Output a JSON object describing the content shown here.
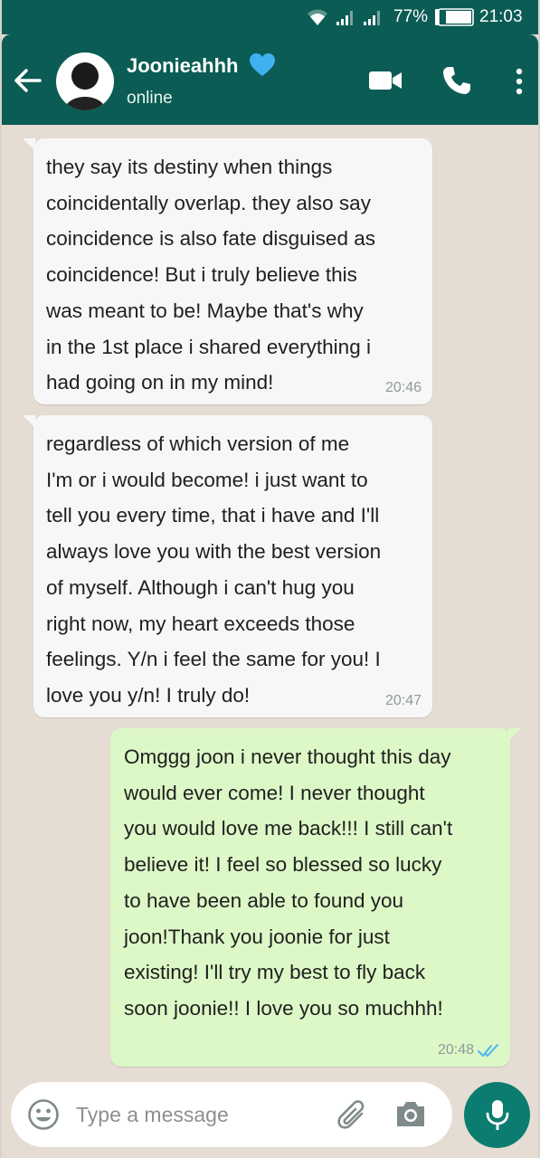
{
  "status_bar": {
    "battery_percent": "77%",
    "time": "21:03",
    "icons": [
      "wifi-icon",
      "signal-icon",
      "signal-icon",
      "battery-icon"
    ]
  },
  "header": {
    "contact_name": "Joonieahhh",
    "status": "online",
    "icons": [
      "back-arrow-icon",
      "avatar",
      "blue-heart-icon",
      "video-call-icon",
      "phone-icon",
      "more-vert-icon"
    ]
  },
  "messages": [
    {
      "direction": "incoming",
      "text": "they say its destiny when things\ncoincidentally overlap. they also say\ncoincidence is also fate disguised as\ncoincidence! But i truly believe this\nwas meant to be! Maybe that's why\nin the 1st place i shared everything i\nhad going on in my mind!",
      "time": "20:46"
    },
    {
      "direction": "incoming",
      "text": "regardless of which version of me\nI'm or i would become! i just want to\ntell you every time, that i have and I'll\nalways love you with the best version\nof myself. Although i can't hug you\nright now, my heart exceeds those\nfeelings. Y/n i feel the same for you! I\nlove you y/n! I truly do!",
      "time": "20:47"
    },
    {
      "direction": "outgoing",
      "text": "Omggg joon i never thought this day\nwould ever come! I never thought\nyou would love me back!!! I still can't\nbelieve it! I feel so blessed so lucky\nto have been able to found you\njoon!Thank you joonie for just\nexisting! I'll try my best to fly back\nsoon joonie!! I love you so muchhh!",
      "time": "20:48",
      "read_status": "read-double-tick-icon"
    }
  ],
  "composer": {
    "placeholder": "Type a message",
    "value": "",
    "icons": [
      "emoji-icon",
      "paperclip-icon",
      "camera-icon",
      "mic-icon"
    ]
  },
  "colors": {
    "header": "#0b5c54",
    "incoming_bubble": "#f7f7f7",
    "outgoing_bubble": "#dcf8c7",
    "chat_background": "#e5ddd3",
    "mic_button": "#0b7d70",
    "read_ticks": "#4fb6ec",
    "heart": "#3fb1f0"
  }
}
